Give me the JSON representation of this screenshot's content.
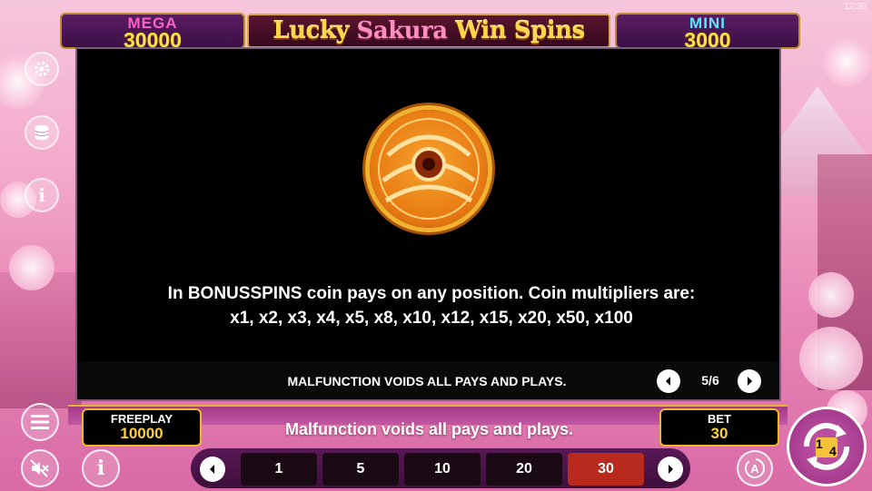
{
  "status": {
    "clock": "12:30"
  },
  "jackpots": {
    "mega": {
      "name": "MEGA",
      "value": "30000",
      "color": "#ff5fc8"
    },
    "mini": {
      "name": "MINI",
      "value": "3000",
      "color": "#5fe6ff"
    }
  },
  "game": {
    "title_part1": "Lucky ",
    "title_part2": "Sakura",
    "title_part3": " Win Spins"
  },
  "side_menu": [
    {
      "name": "settings",
      "icon": "gear-icon"
    },
    {
      "name": "bet-history",
      "icon": "coins-stack-icon"
    },
    {
      "name": "info",
      "icon": "info-icon"
    }
  ],
  "info_panel": {
    "symbol": "coin-icon",
    "description_line1": "In BONUSSPINS coin pays on any position. Coin multipliers are:",
    "description_line2": "x1, x2, x3, x4, x5, x8, x10, x12, x15, x20, x50, x100",
    "malfunction": "MALFUNCTION VOIDS ALL PAYS AND PLAYS.",
    "page": "5/6"
  },
  "balance": {
    "label": "FREEPLAY",
    "value": "10000"
  },
  "bet": {
    "label": "BET",
    "value": "30"
  },
  "footer_message": "Malfunction voids all pays and plays.",
  "bet_options": [
    "1",
    "5",
    "10",
    "20",
    "30"
  ],
  "selected_bet": "30",
  "spin": {
    "label_digit1": "1",
    "label_digit2": "4"
  },
  "colors": {
    "accent_gold": "#f0b82a",
    "selected_bet": "#b82a1e",
    "panel_bg": "#000000"
  }
}
